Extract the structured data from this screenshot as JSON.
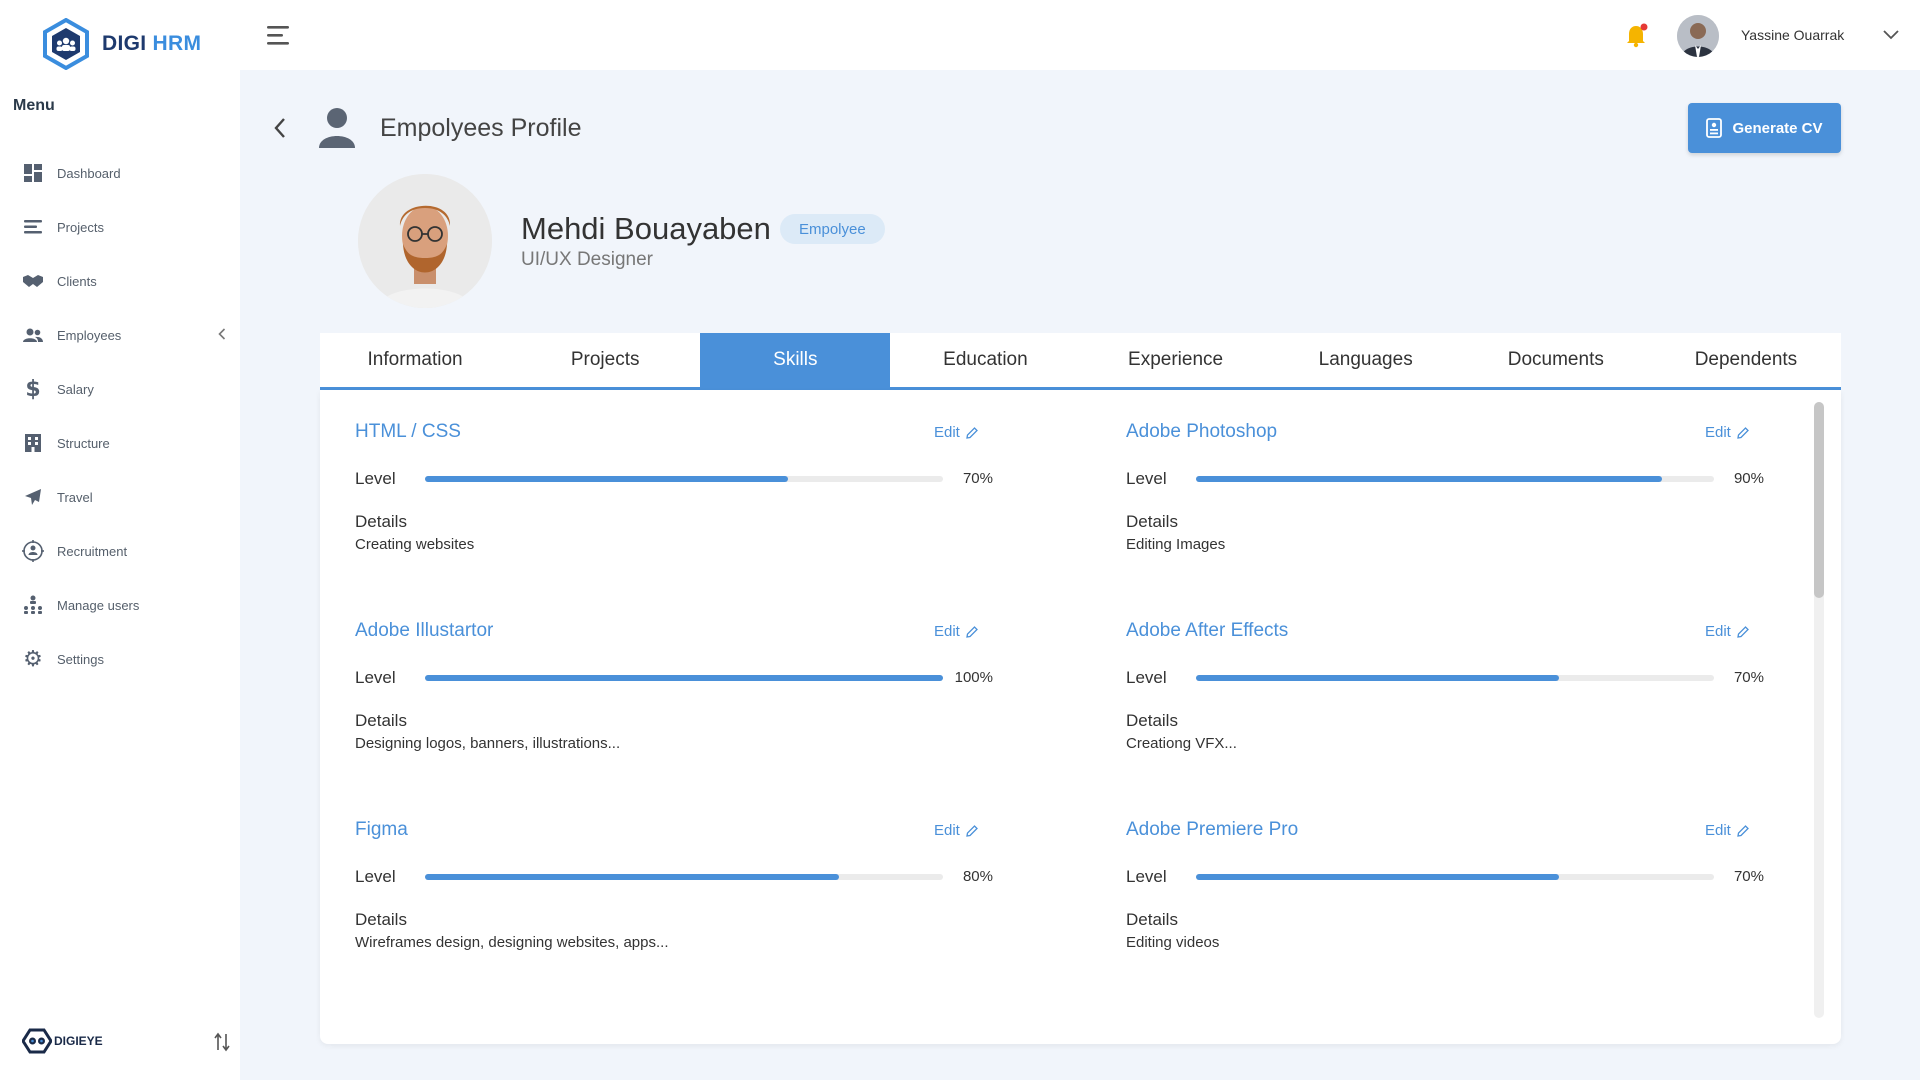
{
  "app": {
    "logo_main": "DIGI",
    "logo_accent": "HRM",
    "footer_logo": "DIGIEYE"
  },
  "sidebar": {
    "menu_title": "Menu",
    "items": [
      {
        "label": "Dashboard",
        "icon": "dashboard-icon"
      },
      {
        "label": "Projects",
        "icon": "projects-icon"
      },
      {
        "label": "Clients",
        "icon": "handshake-icon"
      },
      {
        "label": "Employees",
        "icon": "users-icon"
      },
      {
        "label": "Salary",
        "icon": "dollar-icon"
      },
      {
        "label": "Structure",
        "icon": "building-icon"
      },
      {
        "label": "Travel",
        "icon": "plane-icon"
      },
      {
        "label": "Recruitment",
        "icon": "target-icon"
      },
      {
        "label": "Manage users",
        "icon": "hierarchy-icon"
      },
      {
        "label": "Settings",
        "icon": "gear-icon"
      }
    ]
  },
  "topbar": {
    "user_name": "Yassine Ouarrak"
  },
  "page": {
    "title": "Empolyees Profile",
    "generate_cv_label": "Generate CV"
  },
  "profile": {
    "name": "Mehdi Bouayaben",
    "role_badge": "Empolyee",
    "job_title": "UI/UX Designer"
  },
  "tabs": [
    {
      "label": "Information",
      "active": false
    },
    {
      "label": "Projects",
      "active": false
    },
    {
      "label": "Skills",
      "active": true
    },
    {
      "label": "Education",
      "active": false
    },
    {
      "label": "Experience",
      "active": false
    },
    {
      "label": "Languages",
      "active": false
    },
    {
      "label": "Documents",
      "active": false
    },
    {
      "label": "Dependents",
      "active": false
    }
  ],
  "skills_labels": {
    "edit": "Edit",
    "level": "Level",
    "details": "Details"
  },
  "skills": [
    {
      "name": "HTML / CSS",
      "level": 70,
      "level_text": "70%",
      "details": "Creating websites"
    },
    {
      "name": "Adobe Photoshop",
      "level": 90,
      "level_text": "90%",
      "details": "Editing Images"
    },
    {
      "name": "Adobe Illustartor",
      "level": 100,
      "level_text": "100%",
      "details": "Designing logos, banners, illustrations..."
    },
    {
      "name": "Adobe After Effects",
      "level": 70,
      "level_text": "70%",
      "details": "Creationg VFX..."
    },
    {
      "name": "Figma",
      "level": 80,
      "level_text": "80%",
      "details": "Wireframes design, designing websites, apps..."
    },
    {
      "name": "Adobe Premiere Pro",
      "level": 70,
      "level_text": "70%",
      "details": "Editing videos"
    }
  ],
  "colors": {
    "accent": "#4a90d9",
    "badge_bg": "#dceaf7",
    "notification": "#f5b400",
    "notification_dot": "#e53935"
  }
}
